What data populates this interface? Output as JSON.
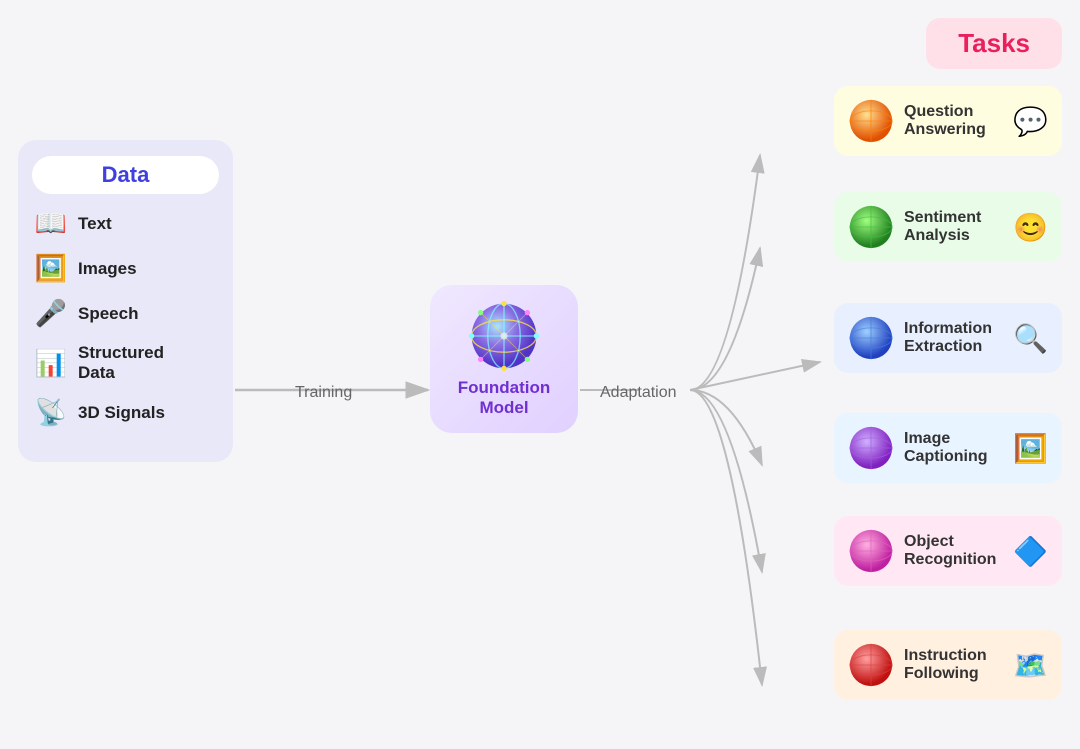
{
  "data_panel": {
    "title": "Data",
    "items": [
      {
        "label": "Text",
        "emoji": "📖"
      },
      {
        "label": "Images",
        "emoji": "🖼️"
      },
      {
        "label": "Speech",
        "emoji": "🎤"
      },
      {
        "label": "Structured\nData",
        "emoji": "📊"
      },
      {
        "label": "3D Signals",
        "emoji": "📡"
      }
    ]
  },
  "foundation_model": {
    "label_line1": "Foundation",
    "label_line2": "Model"
  },
  "labels": {
    "training": "Training",
    "adaptation": "Adaptation"
  },
  "tasks": {
    "title": "Tasks",
    "items": [
      {
        "label": "Question\nAnswering",
        "bg": "#fffde0",
        "emoji": "💬",
        "globe_color": "#e8a000"
      },
      {
        "label": "Sentiment\nAnalysis",
        "bg": "#e8fce8",
        "emoji": "😊",
        "globe_color": "#50c050"
      },
      {
        "label": "Information\nExtraction",
        "bg": "#e8f0ff",
        "emoji": "🔍",
        "globe_color": "#5080e0"
      },
      {
        "label": "Image\nCaptioning",
        "bg": "#e8f8ff",
        "emoji": "🖼️",
        "globe_color": "#a060e0"
      },
      {
        "label": "Object\nRecognition",
        "bg": "#ffe8f0",
        "emoji": "🔷",
        "globe_color": "#e060c0"
      },
      {
        "label": "Instruction\nFollowing",
        "bg": "#fff0e0",
        "emoji": "🗺️",
        "globe_color": "#e04040"
      }
    ]
  }
}
